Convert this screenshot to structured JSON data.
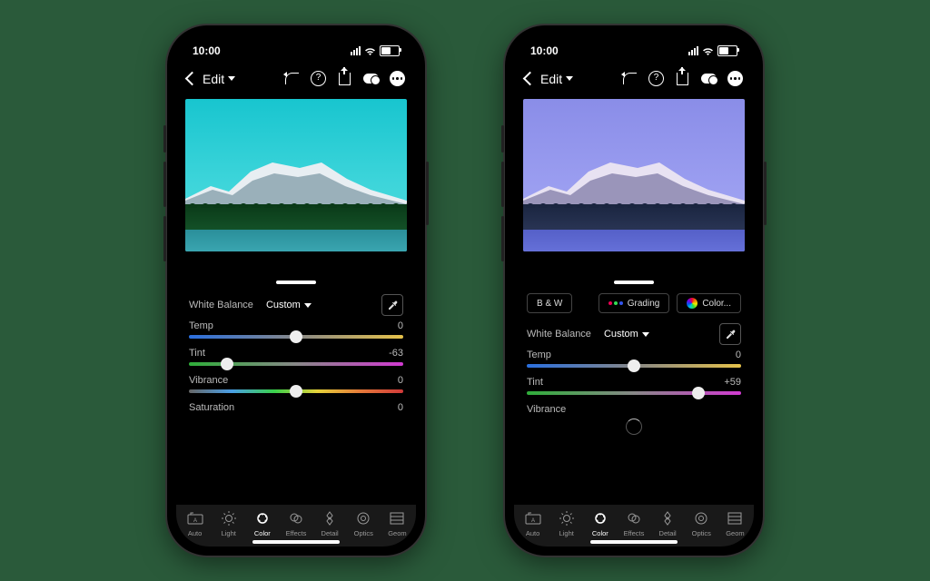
{
  "status": {
    "time": "10:00"
  },
  "topbar": {
    "edit_label": "Edit",
    "icons": [
      "undo",
      "help",
      "share",
      "cloud",
      "more"
    ]
  },
  "left_phone": {
    "sky_variant": "a",
    "panel": {
      "white_balance_label": "White Balance",
      "white_balance_value": "Custom",
      "sliders": [
        {
          "name": "Temp",
          "value": "0",
          "track": "t-temp",
          "thumb_pct": 50
        },
        {
          "name": "Tint",
          "value": "-63",
          "track": "t-tint",
          "thumb_pct": 18
        },
        {
          "name": "Vibrance",
          "value": "0",
          "track": "t-vib",
          "thumb_pct": 50
        },
        {
          "name": "Saturation",
          "value": "0",
          "track": "t-plain",
          "thumb_pct": null
        }
      ]
    }
  },
  "right_phone": {
    "sky_variant": "b",
    "panel": {
      "white_balance_label": "White Balance",
      "white_balance_value": "Custom",
      "section_tabs": {
        "bw": "B & W",
        "grading": "Grading",
        "colormix": "Color..."
      },
      "sliders": [
        {
          "name": "Temp",
          "value": "0",
          "track": "t-temp",
          "thumb_pct": 50
        },
        {
          "name": "Tint",
          "value": "+59",
          "track": "t-tint",
          "thumb_pct": 80
        },
        {
          "name": "Vibrance",
          "value": "",
          "track": "",
          "thumb_pct": null
        }
      ]
    }
  },
  "tabs": [
    {
      "key": "auto",
      "label": "Auto"
    },
    {
      "key": "light",
      "label": "Light"
    },
    {
      "key": "color",
      "label": "Color",
      "active": true
    },
    {
      "key": "effects",
      "label": "Effects"
    },
    {
      "key": "detail",
      "label": "Detail"
    },
    {
      "key": "optics",
      "label": "Optics"
    },
    {
      "key": "geom",
      "label": "Geom"
    }
  ]
}
